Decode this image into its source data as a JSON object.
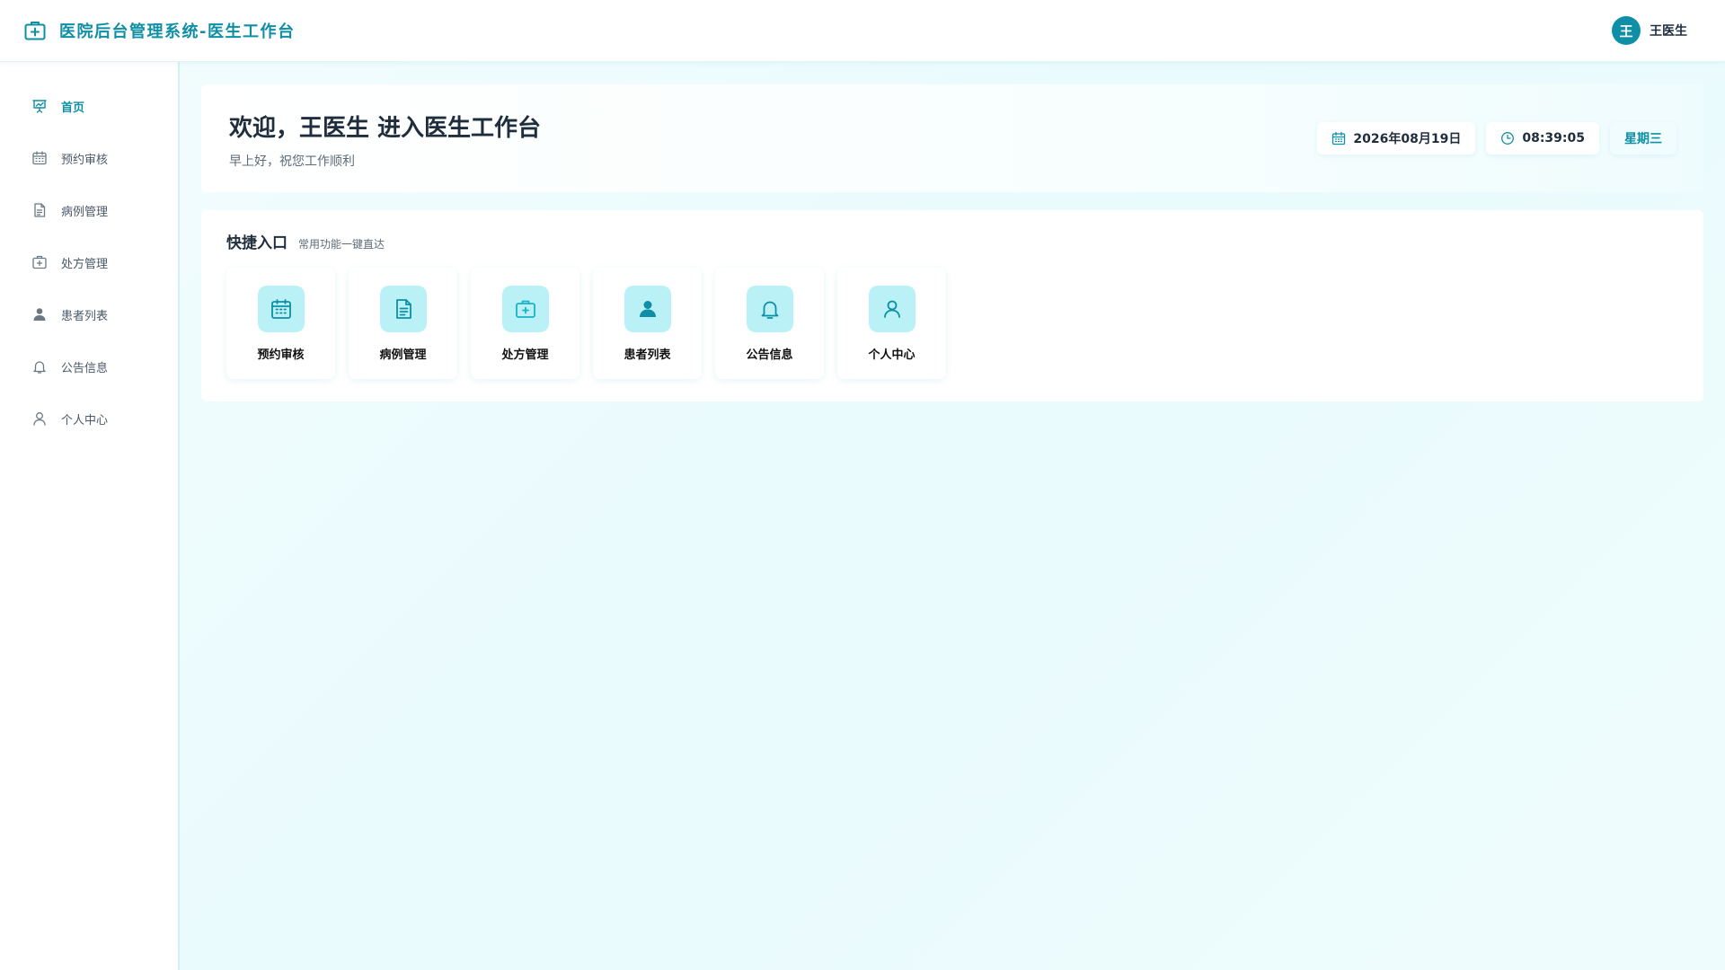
{
  "app": {
    "title": "医院后台管理系统-医生工作台",
    "brand_icon": "medical-kit-icon",
    "accent_color": "#0e8fa6"
  },
  "user": {
    "avatar_text": "王",
    "name": "王医生"
  },
  "sidebar": {
    "items": [
      {
        "label": "首页",
        "icon": "presentation-chart-icon",
        "active": true
      },
      {
        "label": "预约审核",
        "icon": "calendar-icon",
        "active": false
      },
      {
        "label": "病例管理",
        "icon": "document-icon",
        "active": false
      },
      {
        "label": "处方管理",
        "icon": "medical-kit-icon",
        "active": false
      },
      {
        "label": "患者列表",
        "icon": "person-icon",
        "active": false
      },
      {
        "label": "公告信息",
        "icon": "bell-icon",
        "active": false
      },
      {
        "label": "个人中心",
        "icon": "user-outline-icon",
        "active": false
      }
    ]
  },
  "welcome": {
    "title": "欢迎，王医生 进入医生工作台",
    "subtitle": "早上好，祝您工作顺利",
    "date": "2026年08月19日",
    "time": "08:39:05",
    "weekday": "星期三"
  },
  "quick": {
    "title": "快捷入口",
    "subtitle": "常用功能一键直达",
    "tiles": [
      {
        "label": "预约审核",
        "icon": "calendar-icon"
      },
      {
        "label": "病例管理",
        "icon": "document-icon"
      },
      {
        "label": "处方管理",
        "icon": "medical-kit-icon"
      },
      {
        "label": "患者列表",
        "icon": "person-icon"
      },
      {
        "label": "公告信息",
        "icon": "bell-icon"
      },
      {
        "label": "个人中心",
        "icon": "user-outline-icon"
      }
    ]
  }
}
